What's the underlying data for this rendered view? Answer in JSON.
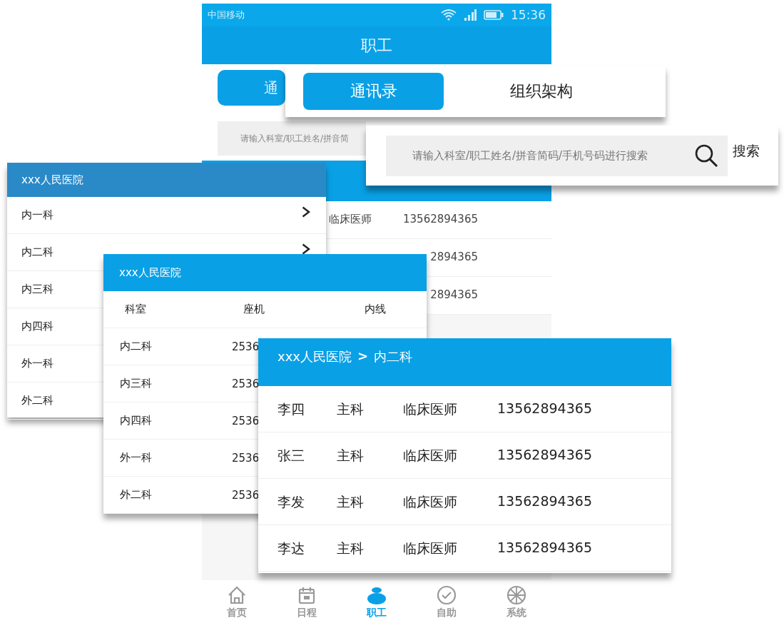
{
  "phone": {
    "status_bar": {
      "carrier": "中国移动",
      "time": "15:36"
    },
    "title": "职工",
    "tab_partial": "通",
    "search_placeholder": "请输入科室/职工姓名/拼音简",
    "rows": [
      {
        "title": "临床医师",
        "phone": "13562894365"
      },
      {
        "phone": "2894365"
      },
      {
        "phone": "2894365"
      }
    ],
    "nav": [
      {
        "label": "首页",
        "selected": false
      },
      {
        "label": "日程",
        "selected": false
      },
      {
        "label": "职工",
        "selected": true
      },
      {
        "label": "自助",
        "selected": false
      },
      {
        "label": "系统",
        "selected": false
      }
    ]
  },
  "tabs_panel": {
    "tabs": [
      {
        "label": "通讯录",
        "selected": true
      },
      {
        "label": "组织架构",
        "selected": false
      }
    ]
  },
  "search_panel": {
    "placeholder": "请输入科室/职工姓名/拼音简码/手机号码进行搜索",
    "button": "搜索"
  },
  "department_list": {
    "header": "xxx人民医院",
    "items": [
      {
        "name": "内一科",
        "arrow": true
      },
      {
        "name": "内二科",
        "arrow": true
      },
      {
        "name": "内三科",
        "arrow": false
      },
      {
        "name": "内四科",
        "arrow": false
      },
      {
        "name": "外一科",
        "arrow": false
      },
      {
        "name": "外二科",
        "arrow": false
      }
    ]
  },
  "extension_table": {
    "header": "xxx人民医院",
    "columns": [
      "科室",
      "座机",
      "内线"
    ],
    "rows": [
      {
        "department": "内二科",
        "landline": "2536"
      },
      {
        "department": "内三科",
        "landline": "2536"
      },
      {
        "department": "内四科",
        "landline": "2536"
      },
      {
        "department": "外一科",
        "landline": "2536"
      },
      {
        "department": "外二科",
        "landline": "2536"
      }
    ]
  },
  "staff_list": {
    "hospital": "xxx人民医院",
    "separator": ">",
    "department": "内二科",
    "rows": [
      {
        "name": "李四",
        "role": "主科",
        "title": "临床医师",
        "phone": "13562894365"
      },
      {
        "name": "张三",
        "role": "主科",
        "title": "临床医师",
        "phone": "13562894365"
      },
      {
        "name": "李发",
        "role": "主科",
        "title": "临床医师",
        "phone": "13562894365"
      },
      {
        "name": "李达",
        "role": "主科",
        "title": "临床医师",
        "phone": "13562894365"
      }
    ]
  }
}
